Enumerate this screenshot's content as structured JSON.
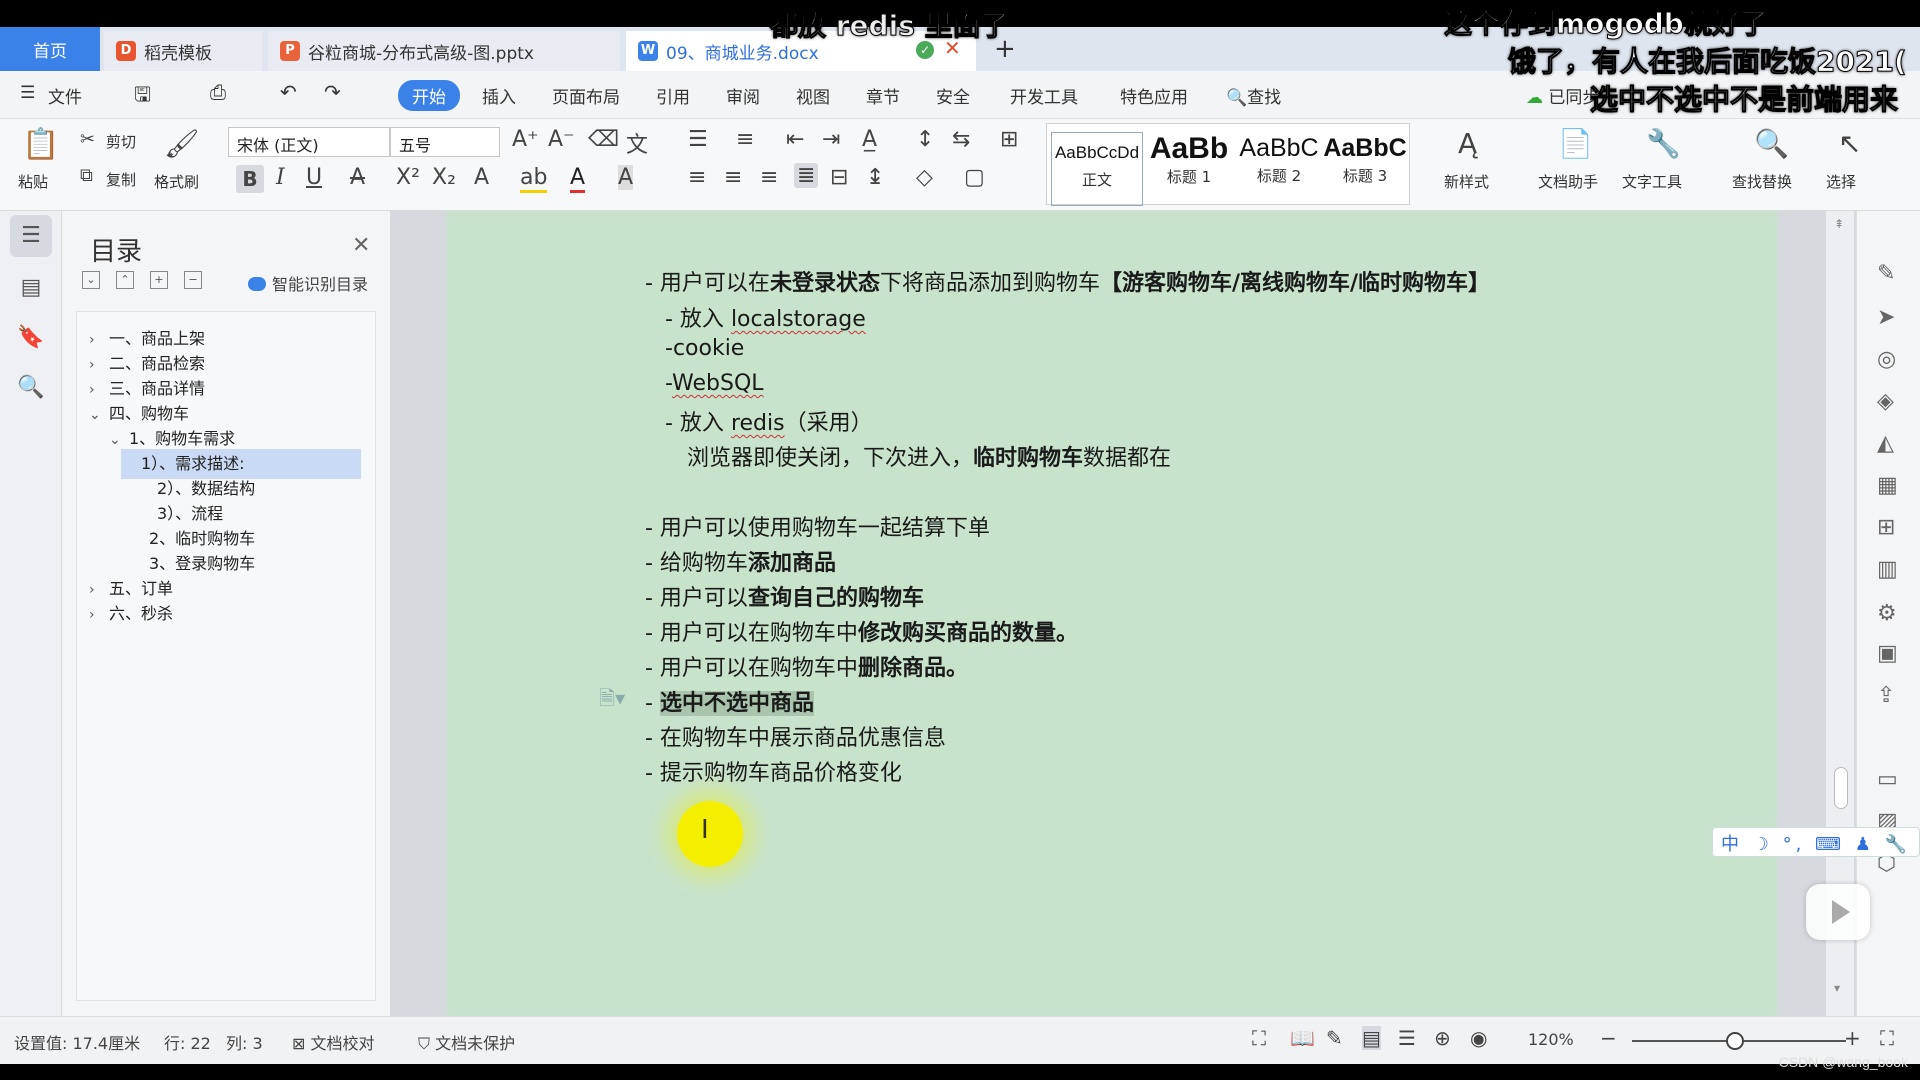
{
  "subtitles": [
    "都放 redis 里面了",
    "这个存到mogodb就好了",
    "饿了，有人在我后面吃饭2021(",
    "选中不选中不是前端用来"
  ],
  "tabs": {
    "home": "首页",
    "templates": "稻壳模板",
    "pptx": "谷粒商城-分布式高级-图.pptx",
    "docx": "09、商城业务.docx",
    "add": "+"
  },
  "menu": {
    "file": "文件",
    "items": [
      "开始",
      "插入",
      "页面布局",
      "引用",
      "审阅",
      "视图",
      "章节",
      "安全",
      "开发工具",
      "特色应用",
      "查找"
    ],
    "sync": "已同步"
  },
  "ribbon": {
    "paste": "粘贴",
    "cut": "剪切",
    "copy": "复制",
    "format_painter": "格式刷",
    "font_name": "宋体 (正文)",
    "font_size": "五号",
    "styles": [
      {
        "sample": "AaBbCcDd",
        "name": "正文"
      },
      {
        "sample": "AaBb",
        "name": "标题 1"
      },
      {
        "sample": "AaBbC",
        "name": "标题 2"
      },
      {
        "sample": "AaBbC",
        "name": "标题 3"
      }
    ],
    "new_style": "新样式",
    "doc_helper": "文档助手",
    "text_tools": "文字工具",
    "find_replace": "查找替换",
    "select": "选择"
  },
  "toc": {
    "title": "目录",
    "smart": "智能识别目录",
    "items": [
      {
        "label": "一、商品上架",
        "chev": "›"
      },
      {
        "label": "二、商品检索",
        "chev": "›"
      },
      {
        "label": "三、商品详情",
        "chev": "›"
      },
      {
        "label": "四、购物车",
        "chev": "⌄"
      },
      {
        "label": "1、购物车需求",
        "chev": "⌄"
      },
      {
        "label": "1）、需求描述:",
        "chev": ""
      },
      {
        "label": "2）、数据结构",
        "chev": ""
      },
      {
        "label": "3）、流程",
        "chev": ""
      },
      {
        "label": "2、临时购物车",
        "chev": ""
      },
      {
        "label": "3、登录购物车",
        "chev": ""
      },
      {
        "label": "五、订单",
        "chev": "›"
      },
      {
        "label": "六、秒杀",
        "chev": "›"
      }
    ]
  },
  "document": {
    "l1a": "- 用户可以在",
    "l1b": "未登录状态",
    "l1c": "下将商品添加到购物车",
    "l1d": "【游客购物车/离线购物车/临时购物车】",
    "l2a": "- 放入 ",
    "l2b": "localstorage",
    "l3": "-cookie",
    "l4a": "-",
    "l4b": "WebSQL",
    "l5a": "- 放入 ",
    "l5b": "redis",
    "l5c": "（采用）",
    "l6a": "浏览器即使关闭，下次进入，",
    "l6b": "临时购物车",
    "l6c": "数据都在",
    "l7": "- 用户可以使用购物车一起结算下单",
    "l8a": "- 给购物车",
    "l8b": "添加商品",
    "l9a": "- 用户可以",
    "l9b": "查询自己的购物车",
    "l10a": "- 用户可以在购物车中",
    "l10b": "修改购买商品的数量。",
    "l11a": "- 用户可以在购物车中",
    "l11b": "删除商品。",
    "l12a": "- ",
    "l12b": "选中不选中商品",
    "l13": "- 在购物车中展示商品优惠信息",
    "l14": "- 提示购物车商品价格变化",
    "cursor": "I"
  },
  "ime": "中 ☽ °, ⌨ ♟ 🔧",
  "status": {
    "setting": "设置值: 17.4厘米",
    "row": "行: 22",
    "col": "列: 3",
    "proof": "文档校对",
    "protect": "文档未保护",
    "zoom": "120%",
    "watermark": "CSDN @wang_book"
  },
  "colors": {
    "accent": "#3b82e8",
    "page_bg": "#c7e3cc"
  }
}
